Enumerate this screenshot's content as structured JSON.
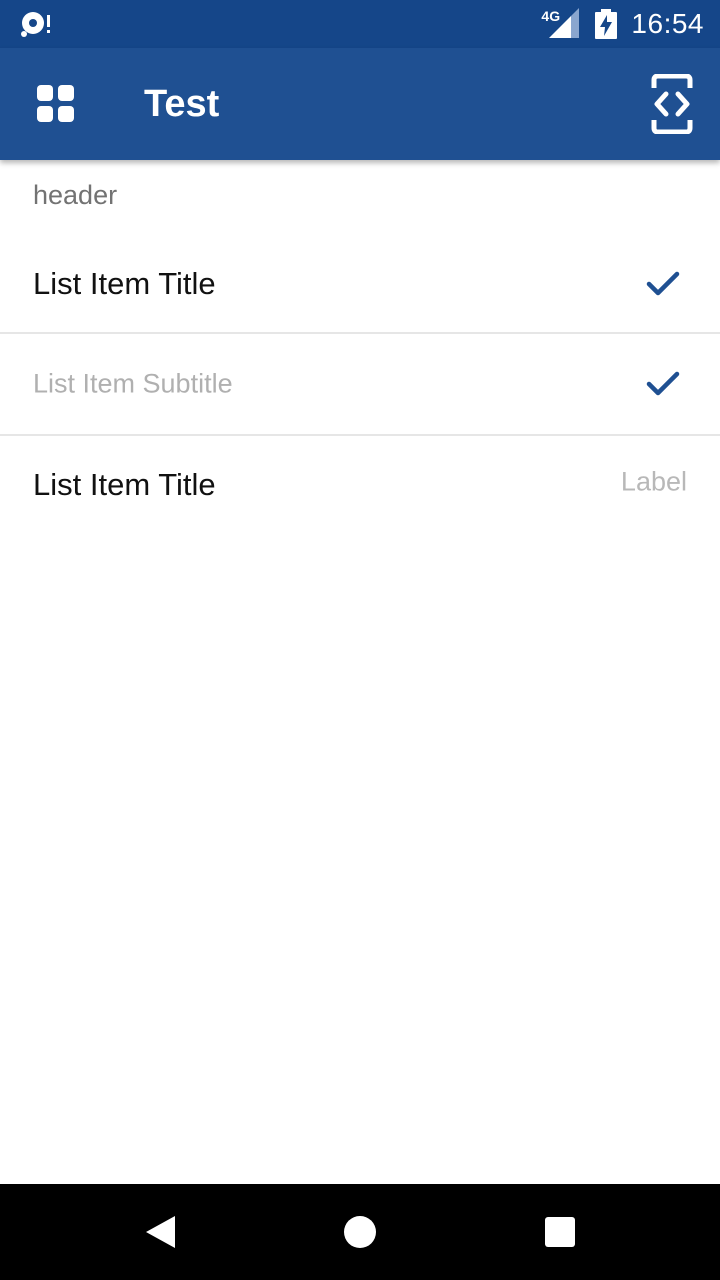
{
  "status_bar": {
    "network": "4G",
    "time": "16:54",
    "icons": [
      "sync-alert-icon",
      "signal-icon",
      "battery-charging-icon"
    ]
  },
  "app_bar": {
    "title": "Test",
    "background": "#1f5092",
    "icons": [
      "grid-icon",
      "code-device-icon"
    ]
  },
  "list": {
    "header": "header",
    "rows": [
      {
        "text": "List Item Title",
        "accessory": "check-icon"
      },
      {
        "text": "List Item Subtitle",
        "accessory": "check-icon"
      },
      {
        "text": "List Item Title",
        "label": "Label"
      }
    ]
  },
  "nav_bar": {
    "icons": [
      "back-icon",
      "home-icon",
      "recents-icon"
    ]
  },
  "colors": {
    "status_bar": "#154689",
    "accent": "#1f5092",
    "check": "#1f5092",
    "divider": "#e6e6e6"
  }
}
